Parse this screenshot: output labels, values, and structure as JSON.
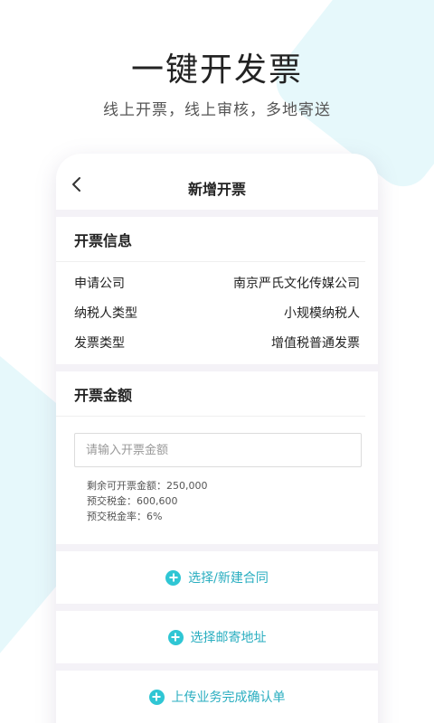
{
  "hero": {
    "title": "一键开发票",
    "subtitle": "线上开票，线上审核，多地寄送"
  },
  "navbar": {
    "title": "新增开票",
    "back_icon": "chevron-left-icon"
  },
  "invoice_info": {
    "title": "开票信息",
    "rows": [
      {
        "label": "申请公司",
        "value": "南京严氏文化传媒公司"
      },
      {
        "label": "纳税人类型",
        "value": "小规模纳税人"
      },
      {
        "label": "发票类型",
        "value": "增值税普通发票"
      }
    ]
  },
  "amount": {
    "title": "开票金额",
    "input_value": "",
    "input_placeholder": "请输入开票金额",
    "notes": [
      "剩余可开票金额：250,000",
      "预交税金：600,600",
      "预交税金率：6%"
    ]
  },
  "actions": [
    {
      "label": "选择/新建合同",
      "icon": "plus-circle-icon"
    },
    {
      "label": "选择邮寄地址",
      "icon": "plus-circle-icon"
    },
    {
      "label": "上传业务完成确认单",
      "icon": "plus-circle-icon"
    }
  ],
  "colors": {
    "accent": "#2fc6d4",
    "accent_text": "#2aaec0",
    "background_shape": "#e6f8fb"
  }
}
